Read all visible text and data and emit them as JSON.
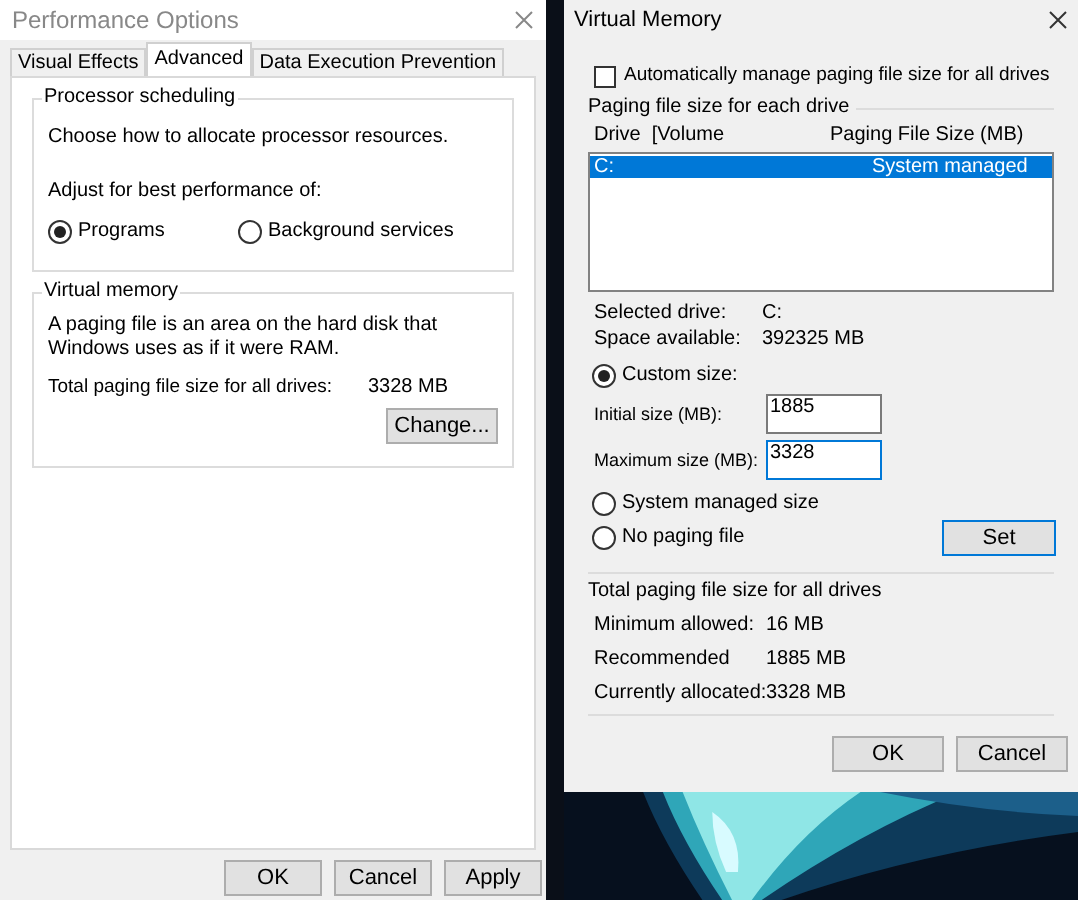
{
  "performance_options": {
    "title": "Performance Options",
    "tabs": [
      {
        "label": "Visual Effects",
        "selected": false
      },
      {
        "label": "Advanced",
        "selected": true
      },
      {
        "label": "Data Execution Prevention",
        "selected": false
      }
    ],
    "processor_scheduling": {
      "heading": "Processor scheduling",
      "description": "Choose how to allocate processor resources.",
      "prompt": "Adjust for best performance of:",
      "options": [
        {
          "label": "Programs",
          "selected": true
        },
        {
          "label": "Background services",
          "selected": false
        }
      ]
    },
    "virtual_memory": {
      "heading": "Virtual memory",
      "description": "A paging file is an area on the hard disk that Windows uses as if it were RAM.",
      "total_label": "Total paging file size for all drives:",
      "total_value": "3328 MB",
      "button": "Change..."
    },
    "buttons": [
      "OK",
      "Cancel",
      "Apply"
    ]
  },
  "virtual_memory_dialog": {
    "title": "Virtual Memory",
    "auto_manage": {
      "label": "Automatically manage paging file size for all drives",
      "checked": false
    },
    "drives_group": "Paging file size for each drive",
    "columns": [
      "Drive  [Volume",
      "Paging File Size (MB)"
    ],
    "rows": [
      {
        "drive": "C:",
        "size": "System managed",
        "selected": true
      }
    ],
    "selected_drive": {
      "label": "Selected drive:",
      "value": "C:"
    },
    "space_available": {
      "label": "Space available:",
      "value": "392325 MB"
    },
    "size_options": [
      {
        "kind": "custom",
        "label": "Custom size:",
        "selected": true
      },
      {
        "kind": "system",
        "label": "System managed size",
        "selected": false
      },
      {
        "kind": "none",
        "label": "No paging file",
        "selected": false
      }
    ],
    "initial_size": {
      "label": "Initial size (MB):",
      "value": "1885"
    },
    "maximum_size": {
      "label": "Maximum size (MB):",
      "value": "3328"
    },
    "set_button": "Set",
    "totals_group": "Total paging file size for all drives",
    "totals": [
      {
        "label": "Minimum allowed:",
        "value": "16 MB"
      },
      {
        "label": "Recommended",
        "value": "1885 MB"
      },
      {
        "label": "Currently allocated:",
        "value": "3328 MB"
      }
    ],
    "buttons": [
      "OK",
      "Cancel"
    ]
  }
}
